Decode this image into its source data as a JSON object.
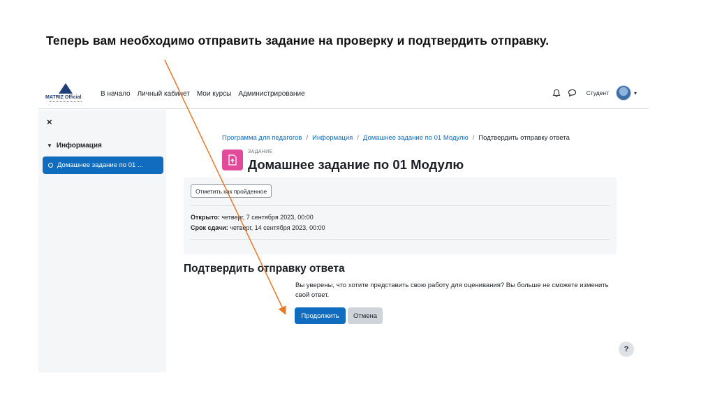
{
  "slide": {
    "title": "Теперь вам необходимо отправить задание на проверку и подтвердить отправку."
  },
  "logo": {
    "text": "MATRIZ Official",
    "icon": "logo-triangle-icon"
  },
  "nav": {
    "links": [
      "В начало",
      "Личный кабинет",
      "Мои курсы",
      "Администрирование"
    ],
    "user_label": "Студент",
    "icons": [
      "bell-icon",
      "chat-icon",
      "avatar",
      "chevron-down-icon"
    ]
  },
  "drawer": {
    "close": "×",
    "section": "Информация",
    "item": "Домашнее задание по 01 ..."
  },
  "breadcrumb": {
    "items": [
      "Программа для педагогов",
      "Информация",
      "Домашнее задание по 01 Модулю"
    ],
    "current": "Подтвердить отправку ответа",
    "separator": "/"
  },
  "activity": {
    "kind": "ЗАДАНИЕ",
    "title": "Домашнее задание по 01 Модулю",
    "icon": "assignment-upload-icon",
    "icon_color": "#e24b9a"
  },
  "info": {
    "mark_done": "Отметить как пройденное",
    "opened_label": "Открыто:",
    "opened_value": "четверг, 7 сентября 2023, 00:00",
    "due_label": "Срок сдачи:",
    "due_value": "четверг, 14 сентября 2023, 00:00"
  },
  "confirm": {
    "title": "Подтвердить отправку ответа",
    "message": "Вы уверены, что хотите представить свою работу для оценивания? Вы больше не сможете изменить свой ответ.",
    "continue": "Продолжить",
    "cancel": "Отмена"
  },
  "help": {
    "label": "?"
  },
  "colors": {
    "primary": "#0f6cbf",
    "annotation_arrow": "#e8782a"
  }
}
